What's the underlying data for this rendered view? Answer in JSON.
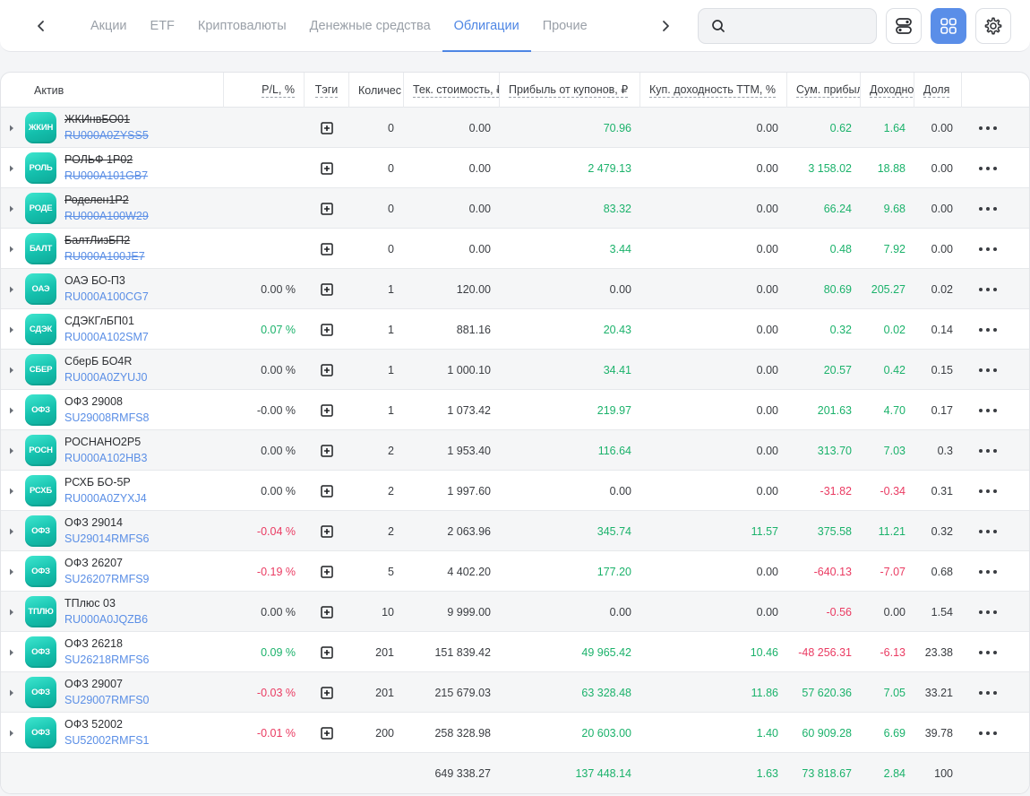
{
  "tabs": [
    "Акции",
    "ETF",
    "Криптовалюты",
    "Денежные средства",
    "Облигации",
    "Прочие"
  ],
  "active_tab": "Облигации",
  "search": {
    "placeholder": "",
    "value": ""
  },
  "colors": {
    "accent": "#4e86e4",
    "positive": "#1bb26b",
    "negative": "#ea3b62",
    "logo": "#1fcdb8"
  },
  "icons": {
    "prev": "chevron-left-icon",
    "next": "chevron-right-icon",
    "search": "search-icon",
    "columns": "toggle-columns-icon",
    "grid": "grid-view-icon",
    "settings": "gear-icon"
  },
  "table": {
    "columns": {
      "asset": "Актив",
      "pl": "P/L, %",
      "tags": "Тэги",
      "qty": "Количес",
      "value": "Тек. стоимость, ₽",
      "coupon": "Прибыль от купонов, ₽",
      "yield_ttm": "Куп. доходность TTM, %",
      "sum_profit": "Сум. прибыль, ₽",
      "yield": "Доходность",
      "share": "Доля"
    },
    "rows": [
      {
        "logo": "ЖКИН",
        "name": "ЖКИнвБО01",
        "isin": "RU000A0ZYSS5",
        "closed": true,
        "pl": "",
        "pl_sign": "",
        "qty": "0",
        "value": "0.00",
        "coupon": "70.96",
        "coupon_sign": "pos",
        "yttm": "0.00",
        "yttm_sign": "",
        "sum": "0.62",
        "sum_sign": "pos",
        "yld": "1.64",
        "yld_sign": "pos",
        "share": "0.00"
      },
      {
        "logo": "РОЛЬ",
        "name": "РОЛЬФ 1Р02",
        "isin": "RU000A101GB7",
        "closed": true,
        "pl": "",
        "pl_sign": "",
        "qty": "0",
        "value": "0.00",
        "coupon": "2 479.13",
        "coupon_sign": "pos",
        "yttm": "0.00",
        "yttm_sign": "",
        "sum": "3 158.02",
        "sum_sign": "pos",
        "yld": "18.88",
        "yld_sign": "pos",
        "share": "0.00"
      },
      {
        "logo": "РОДЕ",
        "name": "Роделен1Р2",
        "isin": "RU000A100W29",
        "closed": true,
        "pl": "",
        "pl_sign": "",
        "qty": "0",
        "value": "0.00",
        "coupon": "83.32",
        "coupon_sign": "pos",
        "yttm": "0.00",
        "yttm_sign": "",
        "sum": "66.24",
        "sum_sign": "pos",
        "yld": "9.68",
        "yld_sign": "pos",
        "share": "0.00"
      },
      {
        "logo": "БАЛТ",
        "name": "БалтЛизБП2",
        "isin": "RU000A100JE7",
        "closed": true,
        "pl": "",
        "pl_sign": "",
        "qty": "0",
        "value": "0.00",
        "coupon": "3.44",
        "coupon_sign": "pos",
        "yttm": "0.00",
        "yttm_sign": "",
        "sum": "0.48",
        "sum_sign": "pos",
        "yld": "7.92",
        "yld_sign": "pos",
        "share": "0.00"
      },
      {
        "logo": "ОАЭ",
        "name": "ОАЭ БО-П3",
        "isin": "RU000A100CG7",
        "closed": false,
        "pl": "0.00 %",
        "pl_sign": "",
        "qty": "1",
        "value": "120.00",
        "coupon": "0.00",
        "coupon_sign": "",
        "yttm": "0.00",
        "yttm_sign": "",
        "sum": "80.69",
        "sum_sign": "pos",
        "yld": "205.27",
        "yld_sign": "pos",
        "share": "0.02"
      },
      {
        "logo": "СДЭК",
        "name": "СДЭКГлБП01",
        "isin": "RU000A102SM7",
        "closed": false,
        "pl": "0.07 %",
        "pl_sign": "pos",
        "qty": "1",
        "value": "881.16",
        "coupon": "20.43",
        "coupon_sign": "pos",
        "yttm": "0.00",
        "yttm_sign": "",
        "sum": "0.32",
        "sum_sign": "pos",
        "yld": "0.02",
        "yld_sign": "pos",
        "share": "0.14"
      },
      {
        "logo": "СБЕР",
        "name": "СберБ БО4R",
        "isin": "RU000A0ZYUJ0",
        "closed": false,
        "pl": "0.00 %",
        "pl_sign": "",
        "qty": "1",
        "value": "1 000.10",
        "coupon": "34.41",
        "coupon_sign": "pos",
        "yttm": "0.00",
        "yttm_sign": "",
        "sum": "20.57",
        "sum_sign": "pos",
        "yld": "0.42",
        "yld_sign": "pos",
        "share": "0.15"
      },
      {
        "logo": "ОФЗ",
        "name": "ОФЗ 29008",
        "isin": "SU29008RMFS8",
        "closed": false,
        "pl": "-0.00 %",
        "pl_sign": "",
        "qty": "1",
        "value": "1 073.42",
        "coupon": "219.97",
        "coupon_sign": "pos",
        "yttm": "0.00",
        "yttm_sign": "",
        "sum": "201.63",
        "sum_sign": "pos",
        "yld": "4.70",
        "yld_sign": "pos",
        "share": "0.17"
      },
      {
        "logo": "РОСН",
        "name": "РОСНАНО2Р5",
        "isin": "RU000A102HB3",
        "closed": false,
        "pl": "0.00 %",
        "pl_sign": "",
        "qty": "2",
        "value": "1 953.40",
        "coupon": "116.64",
        "coupon_sign": "pos",
        "yttm": "0.00",
        "yttm_sign": "",
        "sum": "313.70",
        "sum_sign": "pos",
        "yld": "7.03",
        "yld_sign": "pos",
        "share": "0.3"
      },
      {
        "logo": "РСХБ",
        "name": "РСХБ БО-5Р",
        "isin": "RU000A0ZYXJ4",
        "closed": false,
        "pl": "0.00 %",
        "pl_sign": "",
        "qty": "2",
        "value": "1 997.60",
        "coupon": "0.00",
        "coupon_sign": "",
        "yttm": "0.00",
        "yttm_sign": "",
        "sum": "-31.82",
        "sum_sign": "neg",
        "yld": "-0.34",
        "yld_sign": "neg",
        "share": "0.31"
      },
      {
        "logo": "ОФЗ",
        "name": "ОФЗ 29014",
        "isin": "SU29014RMFS6",
        "closed": false,
        "pl": "-0.04 %",
        "pl_sign": "neg",
        "qty": "2",
        "value": "2 063.96",
        "coupon": "345.74",
        "coupon_sign": "pos",
        "yttm": "11.57",
        "yttm_sign": "pos",
        "sum": "375.58",
        "sum_sign": "pos",
        "yld": "11.21",
        "yld_sign": "pos",
        "share": "0.32"
      },
      {
        "logo": "ОФЗ",
        "name": "ОФЗ 26207",
        "isin": "SU26207RMFS9",
        "closed": false,
        "pl": "-0.19 %",
        "pl_sign": "neg",
        "qty": "5",
        "value": "4 402.20",
        "coupon": "177.20",
        "coupon_sign": "pos",
        "yttm": "0.00",
        "yttm_sign": "",
        "sum": "-640.13",
        "sum_sign": "neg",
        "yld": "-7.07",
        "yld_sign": "neg",
        "share": "0.68"
      },
      {
        "logo": "ТПЛЮ",
        "name": "ТПлюс 03",
        "isin": "RU000A0JQZB6",
        "closed": false,
        "pl": "0.00 %",
        "pl_sign": "",
        "qty": "10",
        "value": "9 999.00",
        "coupon": "0.00",
        "coupon_sign": "",
        "yttm": "0.00",
        "yttm_sign": "",
        "sum": "-0.56",
        "sum_sign": "neg",
        "yld": "0.00",
        "yld_sign": "",
        "share": "1.54"
      },
      {
        "logo": "ОФЗ",
        "name": "ОФЗ 26218",
        "isin": "SU26218RMFS6",
        "closed": false,
        "pl": "0.09 %",
        "pl_sign": "pos",
        "qty": "201",
        "value": "151 839.42",
        "coupon": "49 965.42",
        "coupon_sign": "pos",
        "yttm": "10.46",
        "yttm_sign": "pos",
        "sum": "-48 256.31",
        "sum_sign": "neg",
        "yld": "-6.13",
        "yld_sign": "neg",
        "share": "23.38"
      },
      {
        "logo": "ОФЗ",
        "name": "ОФЗ 29007",
        "isin": "SU29007RMFS0",
        "closed": false,
        "pl": "-0.03 %",
        "pl_sign": "neg",
        "qty": "201",
        "value": "215 679.03",
        "coupon": "63 328.48",
        "coupon_sign": "pos",
        "yttm": "11.86",
        "yttm_sign": "pos",
        "sum": "57 620.36",
        "sum_sign": "pos",
        "yld": "7.05",
        "yld_sign": "pos",
        "share": "33.21"
      },
      {
        "logo": "ОФЗ",
        "name": "ОФЗ 52002",
        "isin": "SU52002RMFS1",
        "closed": false,
        "pl": "-0.01 %",
        "pl_sign": "neg",
        "qty": "200",
        "value": "258 328.98",
        "coupon": "20 603.00",
        "coupon_sign": "pos",
        "yttm": "1.40",
        "yttm_sign": "pos",
        "sum": "60 909.28",
        "sum_sign": "pos",
        "yld": "6.69",
        "yld_sign": "pos",
        "share": "39.78"
      }
    ],
    "totals": {
      "value": "649 338.27",
      "coupon": "137 448.14",
      "yttm": "1.63",
      "sum": "73 818.67",
      "yld": "2.84",
      "share": "100"
    }
  }
}
